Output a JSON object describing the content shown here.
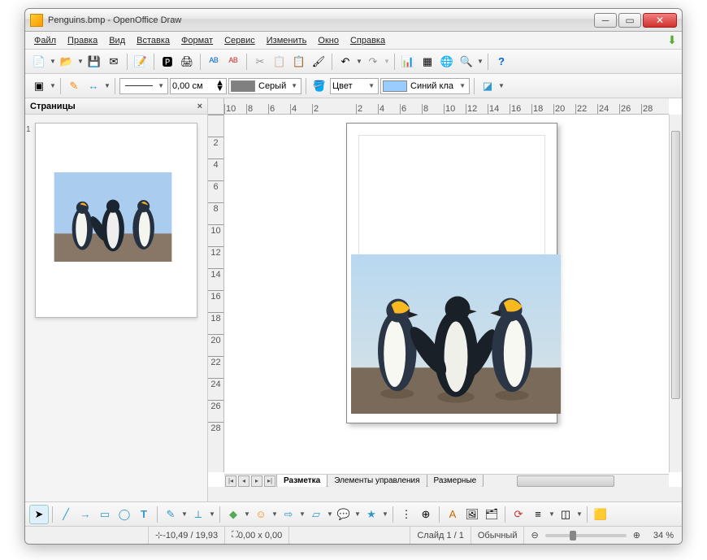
{
  "window": {
    "title": "Penguins.bmp - OpenOffice Draw"
  },
  "menu": {
    "file": "Файл",
    "edit": "Правка",
    "view": "Вид",
    "insert": "Вставка",
    "format": "Формат",
    "tools": "Сервис",
    "modify": "Изменить",
    "window": "Окно",
    "help": "Справка"
  },
  "toolbar2": {
    "line_width": "0,00 см",
    "color1": "Серый",
    "fill_label": "Цвет",
    "color2": "Синий кла"
  },
  "colors": {
    "grey": "#808080",
    "blue": "#99ccff"
  },
  "panel": {
    "title": "Страницы",
    "page_num": "1"
  },
  "ruler_h": [
    "10",
    "8",
    "6",
    "4",
    "2",
    "",
    "2",
    "4",
    "6",
    "8",
    "10",
    "12",
    "14",
    "16",
    "18",
    "20",
    "22",
    "24",
    "26",
    "28"
  ],
  "ruler_v": [
    "",
    "2",
    "4",
    "6",
    "8",
    "10",
    "12",
    "14",
    "16",
    "18",
    "20",
    "22",
    "24",
    "26",
    "28"
  ],
  "tabs": {
    "layout": "Разметка",
    "controls": "Элементы управления",
    "dim": "Размерные"
  },
  "status": {
    "pos": "-10,49 / 19,93",
    "size": "0,00 x 0,00",
    "slide": "Слайд 1 / 1",
    "mode": "Обычный",
    "zoom": "34 %"
  }
}
